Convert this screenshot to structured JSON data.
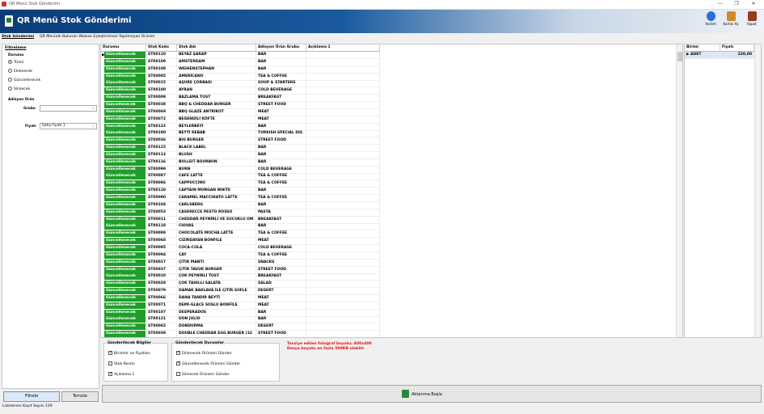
{
  "window": {
    "title": "QR Menü Stok Gönderimi",
    "min_glyph": "—",
    "restore_glyph": "❐",
    "close_glyph": "✕"
  },
  "header": {
    "title": "QR Menü Stok Gönderimi",
    "buttons": [
      {
        "label": "Yardım",
        "icon": "help-icon",
        "color": "#2a6fd6"
      },
      {
        "label": "Kartını Aç",
        "icon": "open-card-icon",
        "color": "#d08a2a"
      },
      {
        "label": "Kapat",
        "icon": "exit-icon",
        "color": "#9a3a20"
      }
    ]
  },
  "tabs": [
    {
      "label": "Stok Gönderimi",
      "active": true
    },
    {
      "label": "QR Menüde Bulunan Wolvox Eşleştirilmesi Yapılmayan Ürünler",
      "active": false
    }
  ],
  "filter": {
    "title": "Filtreleme",
    "status_title": "Durumu",
    "status_options": [
      {
        "label": "Tümü",
        "selected": true
      },
      {
        "label": "Eklenecek",
        "selected": false
      },
      {
        "label": "Güncellenecek",
        "selected": false
      },
      {
        "label": "Silinecek",
        "selected": false
      }
    ],
    "adisyon_title": "Adisyon Ürün",
    "grubu_label": "Grubu",
    "grubu_value": "",
    "fiyati_label": "Fiyatı",
    "fiyati_value": "Satış Fiyatı 1",
    "filter_button": "Filtrele",
    "clear_button": "Temizle"
  },
  "status_bar": "Listelenen Kayıt Sayısı 129",
  "grid": {
    "columns": [
      "Durumu",
      "Stok Kodu",
      "Stok Adı",
      "Adisyon Ürün Grubu",
      "Açıklama 1"
    ],
    "status_color": "#1f9e2a",
    "rows": [
      [
        "Güncellenecek",
        "ST00110",
        "BEYAZ ŞARAP",
        "BAR"
      ],
      [
        "Güncellenecek",
        "ST00109",
        "AMSTERDAM",
        "BAR"
      ],
      [
        "Güncellenecek",
        "ST00108",
        "WEIHENSTEPHAN",
        "BAR"
      ],
      [
        "Güncellenecek",
        "ST00085",
        "AMERİCANO",
        "TEA & COFFEE"
      ],
      [
        "Güncellenecek",
        "ST00015",
        "AŞURE ÇORBASI",
        "SOUP & STARTERS"
      ],
      [
        "Güncellenecek",
        "ST00100",
        "AYRAN",
        "COLD BEVERAGE"
      ],
      [
        "Güncellenecek",
        "ST00009",
        "BAZLAMA TOST",
        "BREAKFAST"
      ],
      [
        "Güncellenecek",
        "ST00038",
        "BBQ & CHEDDAR BURGER",
        "STREET FOOD"
      ],
      [
        "Güncellenecek",
        "ST00069",
        "BBQ GLAZE ANTRİKOT",
        "MEAT"
      ],
      [
        "Güncellenecek",
        "ST00072",
        "BEĞENDİLİ KÖFTE",
        "MEAT"
      ],
      [
        "Güncellenecek",
        "ST00122",
        "BEYLERBEYİ",
        "BAR"
      ],
      [
        "Güncellenecek",
        "ST00190",
        "BEYTİ KEBAB",
        "TURKISH SPECIAL DIS"
      ],
      [
        "Güncellenecek",
        "ST00036",
        "BIG BURGER",
        "STREET FOOD"
      ],
      [
        "Güncellenecek",
        "ST00115",
        "BLACK LABEL",
        "BAR"
      ],
      [
        "Güncellenecek",
        "ST00113",
        "BLUSH",
        "BAR"
      ],
      [
        "Güncellenecek",
        "ST00116",
        "BULLEIT BOURBON",
        "BAR"
      ],
      [
        "Güncellenecek",
        "ST00099",
        "BURN",
        "COLD BEVERAGE"
      ],
      [
        "Güncellenecek",
        "ST00087",
        "CAFE LATTE",
        "TEA & COFFEE"
      ],
      [
        "Güncellenecek",
        "ST00086",
        "CAPPUCCINO",
        "TEA & COFFEE"
      ],
      [
        "Güncellenecek",
        "ST00120",
        "CAPTAIN MORGAN WHITE",
        "BAR"
      ],
      [
        "Güncellenecek",
        "ST00090",
        "CARAMEL MACCHIATO LATTE",
        "TEA & COFFEE"
      ],
      [
        "Güncellenecek",
        "ST00104",
        "CARLSBERG",
        "BAR"
      ],
      [
        "Güncellenecek",
        "ST00053",
        "CASERECCE PESTO ROSSO",
        "PASTA"
      ],
      [
        "Güncellenecek",
        "ST00011",
        "CHEDDAR PEYNİRLİ VE SUCUKLU OM",
        "BREAKFAST"
      ],
      [
        "Güncellenecek",
        "ST00118",
        "CHIVAS",
        "BAR"
      ],
      [
        "Güncellenecek",
        "ST00089",
        "CHOCOLATE MOCHA LATTE",
        "TEA & COFFEE"
      ],
      [
        "Güncellenecek",
        "ST00068",
        "CIZIRDAYAN BONFİLE",
        "MEAT"
      ],
      [
        "Güncellenecek",
        "ST00095",
        "COCA-COLA",
        "COLD BEVERAGE"
      ],
      [
        "Güncellenecek",
        "ST00094",
        "ÇAY",
        "TEA & COFFEE"
      ],
      [
        "Güncellenecek",
        "ST00027",
        "ÇITIR MANTI",
        "SNACKS"
      ],
      [
        "Güncellenecek",
        "ST00037",
        "ÇITIR TAVUK BURGER",
        "STREET FOOD"
      ],
      [
        "Güncellenecek",
        "ST00010",
        "ÇOK PEYNİRLİ TOST",
        "BREAKFAST"
      ],
      [
        "Güncellenecek",
        "ST00029",
        "ÇOK TAHILLI SALATA",
        "SALAD"
      ],
      [
        "Güncellenecek",
        "ST00079",
        "DAMAK BAKLAVA İLE ÇITIR SUFLE",
        "DESERT"
      ],
      [
        "Güncellenecek",
        "ST00066",
        "DANA TANDIR BEYTİ",
        "MEAT"
      ],
      [
        "Güncellenecek",
        "ST00071",
        "DEMİ-GLACE SOSLU BONFİLE",
        "MEAT"
      ],
      [
        "Güncellenecek",
        "ST00107",
        "DESPERADOS",
        "BAR"
      ],
      [
        "Güncellenecek",
        "ST00121",
        "DON JULIO",
        "BAR"
      ],
      [
        "Güncellenecek",
        "ST00082",
        "DONDURMA",
        "DESERT"
      ],
      [
        "Güncellenecek",
        "ST00039",
        "DOUBLE CHEDDAR EGG BURGER (32",
        "STREET FOOD"
      ]
    ]
  },
  "unit_grid": {
    "columns": [
      "Birimi",
      "Fiyatı"
    ],
    "rows": [
      [
        "ADET",
        "220,00"
      ]
    ]
  },
  "send_info": {
    "title": "Gönderilecek Bilgiler",
    "items": [
      {
        "label": "Birimler ve Fiyatları",
        "checked": true
      },
      {
        "label": "Stok Resmi",
        "checked": false
      },
      {
        "label": "Açıklama 1",
        "checked": true
      }
    ]
  },
  "send_status": {
    "title": "Gönderilecek Durumlar",
    "items": [
      {
        "label": "Eklenecek Ürünleri Gönder",
        "checked": true
      },
      {
        "label": "Güncellenecek Ürünleri Gönder",
        "checked": true
      },
      {
        "label": "Silinecek Ürünleri Gönder",
        "checked": false
      }
    ]
  },
  "warning": {
    "line1": "Tavsiye edilen fotoğraf boyutu: 400x400",
    "line2": "Dosya boyutu en fazla 500KB olabilir"
  },
  "transfer_button": "Aktarıma Başla",
  "glyphs": {
    "row_marker": "▶",
    "dropdown": "⌵",
    "scroll_up": "▲",
    "scroll_down": "▼"
  }
}
